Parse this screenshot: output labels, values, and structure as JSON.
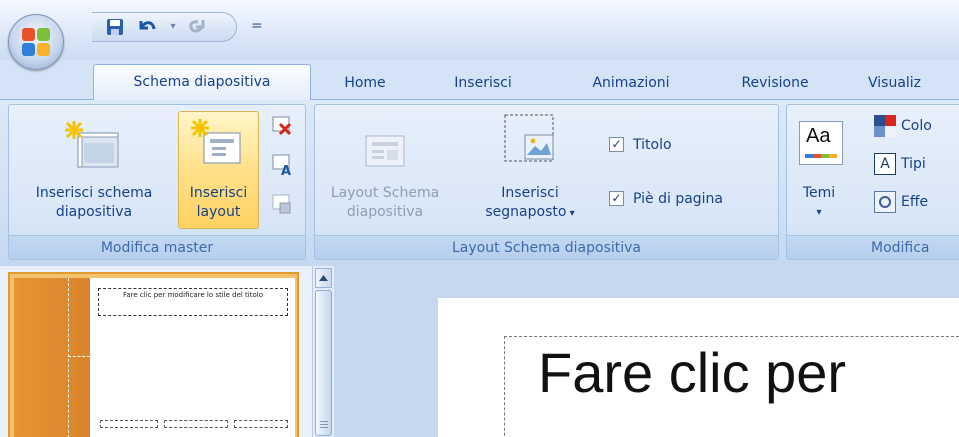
{
  "quick_access": {
    "save_icon": "save-icon",
    "undo_icon": "undo-icon",
    "redo_icon": "redo-icon",
    "more": "="
  },
  "tabs": [
    {
      "label": "Schema diapositiva",
      "active": true
    },
    {
      "label": "Home"
    },
    {
      "label": "Inserisci"
    },
    {
      "label": "Animazioni"
    },
    {
      "label": "Revisione"
    },
    {
      "label": "Visualiz"
    }
  ],
  "groups": {
    "modifica_master": {
      "title": "Modifica master",
      "insert_master_line1": "Inserisci schema",
      "insert_master_line2": "diapositiva",
      "insert_layout_line1": "Inserisci",
      "insert_layout_line2": "layout"
    },
    "layout": {
      "title": "Layout Schema diapositiva",
      "layout_master_line1": "Layout Schema",
      "layout_master_line2": "diapositiva",
      "insert_placeholder_line1": "Inserisci",
      "insert_placeholder_line2": "segnaposto",
      "title_check": "Titolo",
      "footer_check": "Piè di pagina"
    },
    "modifica": {
      "title": "Modifica",
      "themes": "Temi",
      "colors": "Colo",
      "fonts": "Tipi",
      "effects": "Effe",
      "aa": "Aa",
      "a_letter": "A"
    }
  },
  "thumbnail": {
    "title_text": "Fare clic per modificare lo stile del titolo"
  },
  "slide": {
    "title_text": "Fare clic per"
  },
  "colors": {
    "ribbon": "#d5e3f6",
    "highlight": "#ffd260",
    "slide_orange": "#e69534"
  }
}
